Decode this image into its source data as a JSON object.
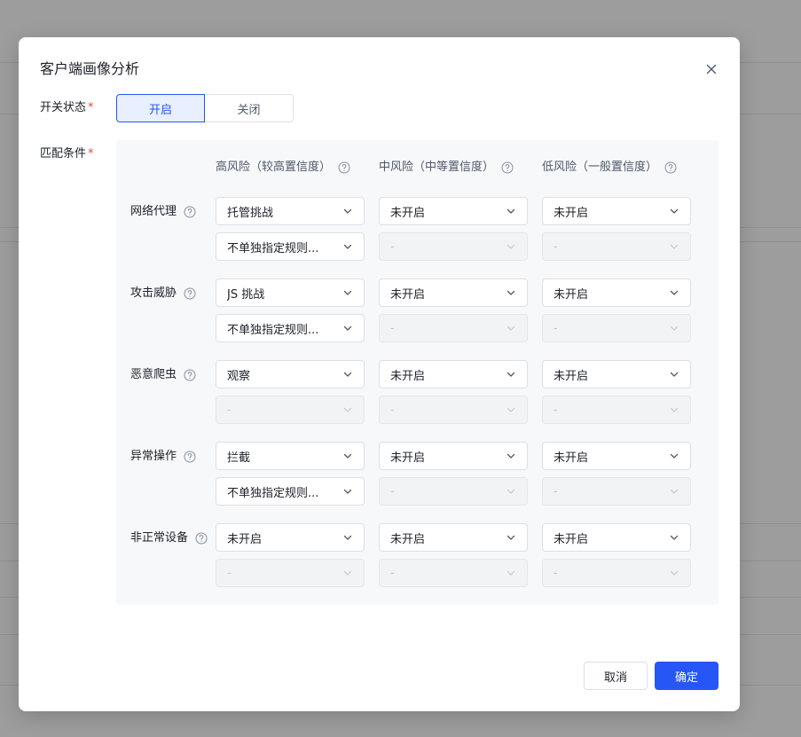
{
  "dialog": {
    "title": "客户端画像分析"
  },
  "form": {
    "switch_label": "开关状态",
    "required_mark": "*",
    "switch_on": "开启",
    "switch_off": "关闭",
    "condition_label": "匹配条件"
  },
  "columns": [
    {
      "label": "高风险（较高置信度）"
    },
    {
      "label": "中风险（中等置信度）"
    },
    {
      "label": "低风险（一般置信度）"
    }
  ],
  "rows": [
    {
      "label": "网络代理",
      "action": [
        "托管挑战",
        "未开启",
        "未开启"
      ],
      "rule": [
        "不单独指定规则...",
        "-",
        "-"
      ]
    },
    {
      "label": "攻击威胁",
      "action": [
        "JS 挑战",
        "未开启",
        "未开启"
      ],
      "rule": [
        "不单独指定规则...",
        "-",
        "-"
      ]
    },
    {
      "label": "恶意爬虫",
      "action": [
        "观察",
        "未开启",
        "未开启"
      ],
      "rule": [
        "-",
        "-",
        "-"
      ]
    },
    {
      "label": "异常操作",
      "action": [
        "拦截",
        "未开启",
        "未开启"
      ],
      "rule": [
        "不单独指定规则...",
        "-",
        "-"
      ]
    },
    {
      "label": "非正常设备",
      "action": [
        "未开启",
        "未开启",
        "未开启"
      ],
      "rule": [
        "-",
        "-",
        "-"
      ]
    }
  ],
  "footer": {
    "cancel": "取消",
    "confirm": "确定"
  },
  "colors": {
    "primary": "#2656f5",
    "required": "#f53f3f"
  }
}
